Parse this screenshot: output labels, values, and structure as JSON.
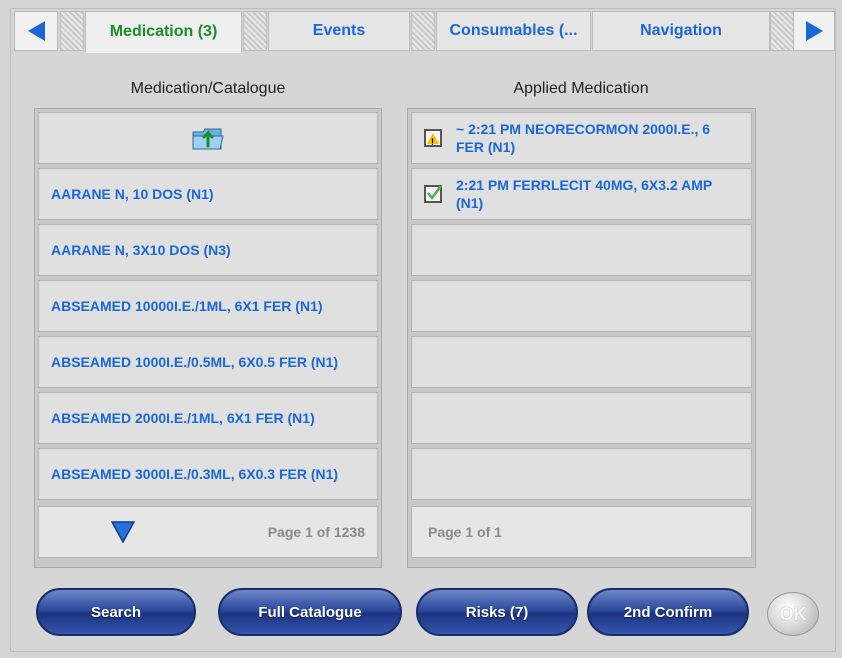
{
  "tabs": [
    {
      "label": "Medication (3)",
      "active": true
    },
    {
      "label": "Events",
      "active": false
    },
    {
      "label": "Consumables (...",
      "active": false
    },
    {
      "label": "Navigation",
      "active": false
    }
  ],
  "left_column": {
    "title": "Medication/Catalogue",
    "items": [
      "AARANE N, 10 DOS (N1)",
      "AARANE N, 3X10 DOS (N3)",
      "ABSEAMED 10000I.E./1ML, 6X1 FER (N1)",
      "ABSEAMED 1000I.E./0.5ML, 6X0.5 FER (N1)",
      "ABSEAMED 2000I.E./1ML, 6X1 FER (N1)",
      "ABSEAMED 3000I.E./0.3ML, 6X0.3 FER (N1)"
    ],
    "page": "Page 1 of 1238"
  },
  "right_column": {
    "title": "Applied Medication",
    "items": [
      {
        "text": "~ 2:21 PM NEORECORMON 2000I.E., 6 FER (N1)",
        "status": "warning"
      },
      {
        "text": "2:21 PM FERRLECIT 40MG, 6X3.2 AMP (N1)",
        "status": "confirmed"
      }
    ],
    "page": "Page 1 of 1"
  },
  "buttons": {
    "search": "Search",
    "full_catalogue": "Full Catalogue",
    "risks": "Risks (7)",
    "second_confirm": "2nd Confirm",
    "ok": "OK"
  },
  "colors": {
    "accent_blue": "#1a68d8",
    "active_tab_green": "#1b8d2a",
    "button_navy": "#2b4a9e",
    "warning_yellow": "#f1c200",
    "check_green": "#4caf50"
  }
}
